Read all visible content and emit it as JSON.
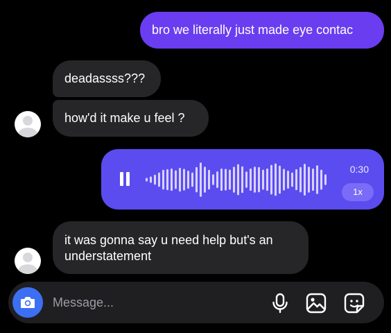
{
  "conversation": {
    "messages": [
      {
        "sender": "me",
        "text": "bro we literally just made eye contac"
      },
      {
        "sender": "them",
        "text": "deadassss???"
      },
      {
        "sender": "them",
        "text": "how'd it make u feel ?"
      },
      {
        "sender": "me",
        "type": "voice",
        "duration": "0:30",
        "speed": "1x"
      },
      {
        "sender": "them",
        "text": "it was gonna say u need help but's an understatement"
      }
    ]
  },
  "voice_waveform": [
    0.1,
    0.18,
    0.28,
    0.4,
    0.55,
    0.58,
    0.62,
    0.52,
    0.66,
    0.6,
    0.5,
    0.4,
    0.7,
    0.95,
    0.72,
    0.55,
    0.3,
    0.46,
    0.62,
    0.6,
    0.56,
    0.72,
    0.86,
    0.74,
    0.45,
    0.62,
    0.72,
    0.7,
    0.56,
    0.62,
    0.82,
    0.9,
    0.78,
    0.6,
    0.5,
    0.4,
    0.58,
    0.7,
    0.88,
    0.72,
    0.62,
    0.8,
    0.56,
    0.3
  ],
  "composer": {
    "placeholder": "Message..."
  },
  "icons": {
    "camera": "camera-icon",
    "mic": "microphone-icon",
    "gallery": "gallery-icon",
    "sticker": "sticker-icon",
    "pause": "pause-icon"
  },
  "colors": {
    "background": "#000000",
    "sent_bubble": "#6a3df0",
    "voice_bubble": "#5b4cf0",
    "received_bubble": "#262629",
    "camera_button": "#3d6ff2"
  }
}
